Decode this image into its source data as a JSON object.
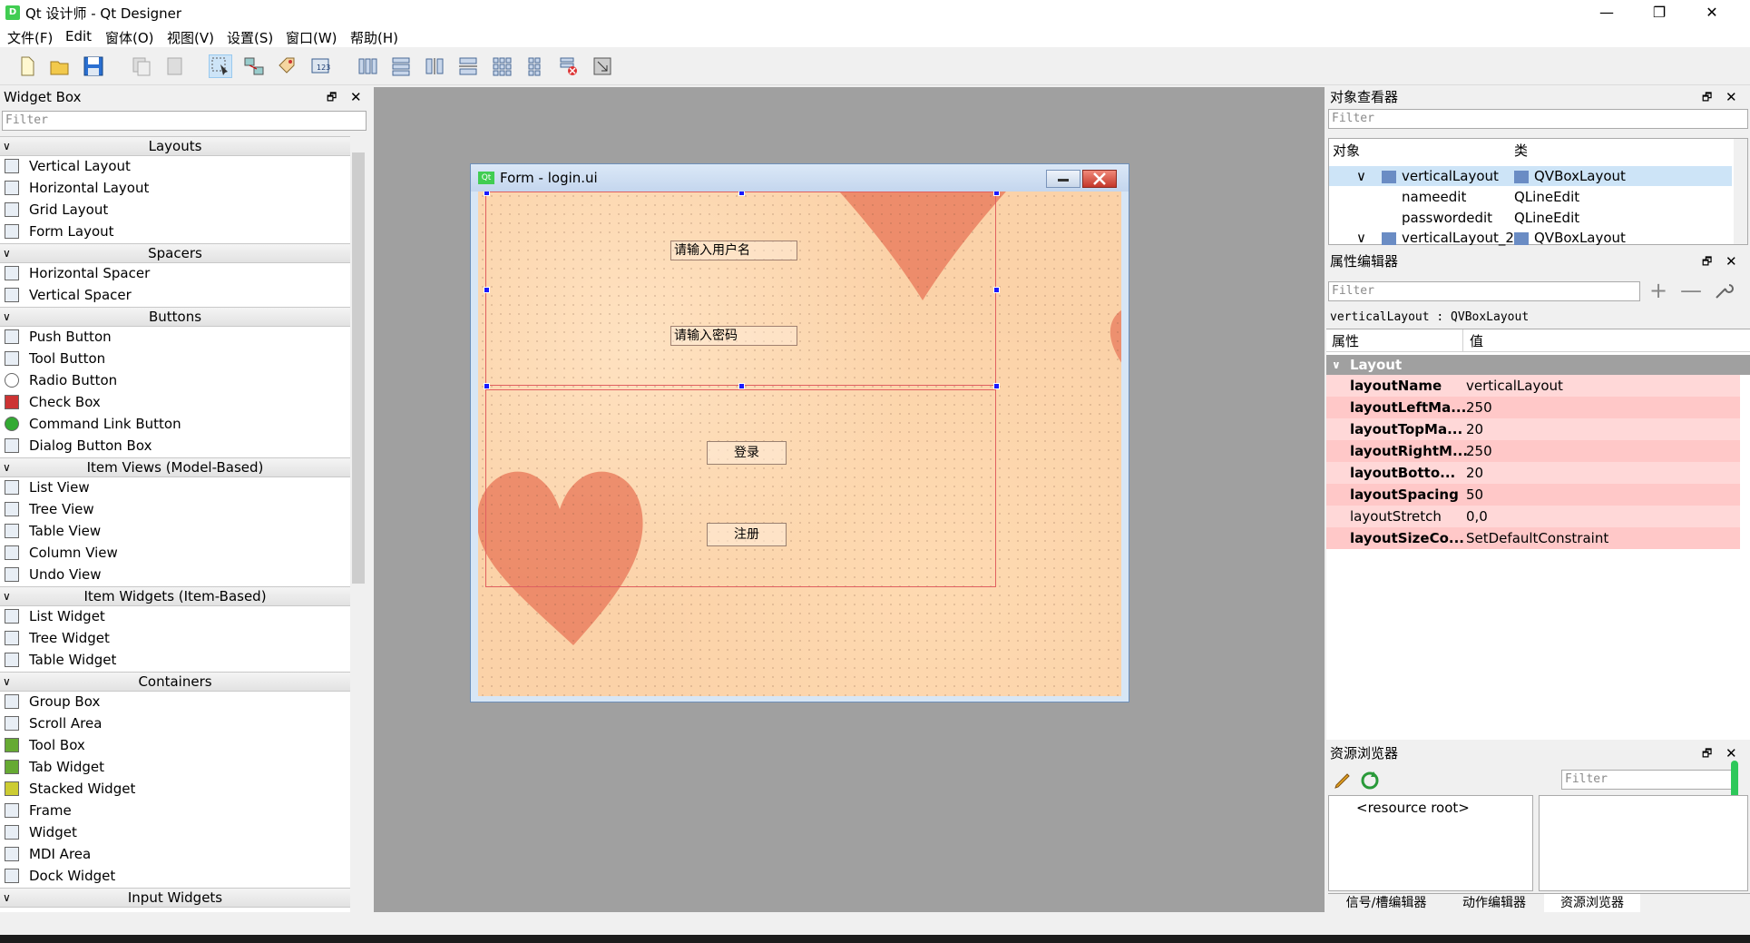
{
  "window": {
    "app_icon_text": "D",
    "title": "Qt 设计师 - Qt Designer",
    "minimize": "—",
    "maximize": "❐",
    "close": "✕"
  },
  "menubar": [
    "文件(F)",
    "Edit",
    "窗体(O)",
    "视图(V)",
    "设置(S)",
    "窗口(W)",
    "帮助(H)"
  ],
  "widget_box": {
    "title": "Widget Box",
    "float_icon": "🗗",
    "close_icon": "✕",
    "filter_placeholder": "Filter",
    "categories": [
      {
        "name": "Layouts",
        "items": [
          "Vertical Layout",
          "Horizontal Layout",
          "Grid Layout",
          "Form Layout"
        ]
      },
      {
        "name": "Spacers",
        "items": [
          "Horizontal Spacer",
          "Vertical Spacer"
        ]
      },
      {
        "name": "Buttons",
        "items": [
          "Push Button",
          "Tool Button",
          "Radio Button",
          "Check Box",
          "Command Link Button",
          "Dialog Button Box"
        ]
      },
      {
        "name": "Item Views (Model-Based)",
        "items": [
          "List View",
          "Tree View",
          "Table View",
          "Column View",
          "Undo View"
        ]
      },
      {
        "name": "Item Widgets (Item-Based)",
        "items": [
          "List Widget",
          "Tree Widget",
          "Table Widget"
        ]
      },
      {
        "name": "Containers",
        "items": [
          "Group Box",
          "Scroll Area",
          "Tool Box",
          "Tab Widget",
          "Stacked Widget",
          "Frame",
          "Widget",
          "MDI Area",
          "Dock Widget"
        ]
      },
      {
        "name": "Input Widgets",
        "items": []
      }
    ]
  },
  "form": {
    "qt_icon": "Qt",
    "title": "Form - login.ui",
    "username_placeholder": "请输入用户名",
    "password_placeholder": "请输入密码",
    "login_button": "登录",
    "register_button": "注册"
  },
  "object_inspector": {
    "title": "对象查看器",
    "filter_placeholder": "Filter",
    "col_object": "对象",
    "col_class": "类",
    "rows": [
      {
        "object": "verticalLayout",
        "class": "QVBoxLayout"
      },
      {
        "object": "nameedit",
        "class": "QLineEdit"
      },
      {
        "object": "passwordedit",
        "class": "QLineEdit"
      },
      {
        "object": "verticalLayout_2",
        "class": "QVBoxLayout"
      }
    ]
  },
  "property_editor": {
    "title": "属性编辑器",
    "filter_placeholder": "Filter",
    "object_label": "verticalLayout : QVBoxLayout",
    "col_property": "属性",
    "col_value": "值",
    "group": "Layout",
    "properties": [
      {
        "name": "layoutName",
        "value": "verticalLayout",
        "bold": true
      },
      {
        "name": "layoutLeftMa...",
        "value": "250",
        "bold": true
      },
      {
        "name": "layoutTopMa...",
        "value": "20",
        "bold": true
      },
      {
        "name": "layoutRightM...",
        "value": "250",
        "bold": true
      },
      {
        "name": "layoutBotto...",
        "value": "20",
        "bold": true
      },
      {
        "name": "layoutSpacing",
        "value": "50",
        "bold": true
      },
      {
        "name": "layoutStretch",
        "value": "0,0",
        "bold": false
      },
      {
        "name": "layoutSizeCo...",
        "value": "SetDefaultConstraint",
        "bold": true
      }
    ]
  },
  "resource_browser": {
    "title": "资源浏览器",
    "filter_placeholder": "Filter",
    "root": "<resource root>",
    "tabs": [
      "信号/槽编辑器",
      "动作编辑器",
      "资源浏览器"
    ]
  },
  "colors": {
    "prop_row_bg": "#ffd8d8",
    "prop_row_alt": "#ffc8c8",
    "selection": "#cde4f7",
    "group_header": "#a0a0a0",
    "heart": "#ea8060"
  }
}
